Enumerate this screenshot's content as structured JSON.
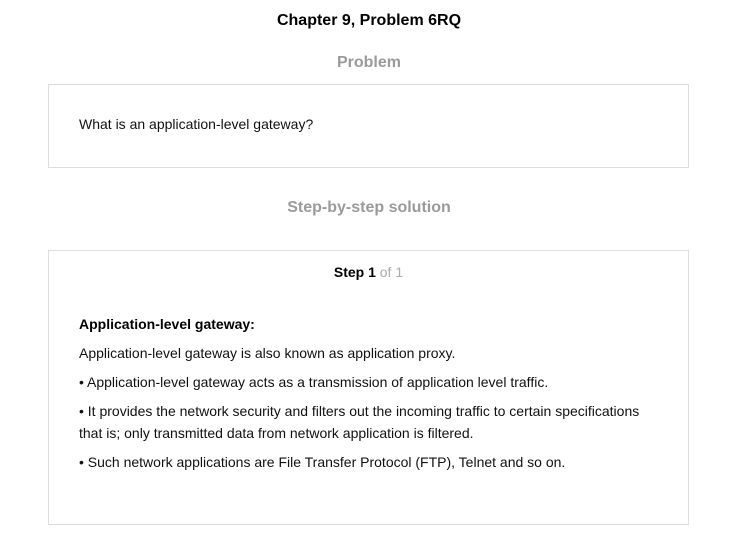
{
  "chapter": {
    "title": "Chapter 9, Problem 6RQ"
  },
  "problem": {
    "heading": "Problem",
    "text": "What is an application-level gateway?"
  },
  "solution": {
    "heading": "Step-by-step solution",
    "step": {
      "label": "Step 1",
      "of": "of 1",
      "title": "Application-level gateway:",
      "paragraphs": [
        "Application-level gateway is also known as application proxy.",
        "• Application-level gateway acts as a transmission of application level traffic.",
        "• It provides the network security and filters out the incoming traffic to certain specifications that is; only transmitted data from network application is filtered.",
        "• Such network applications are File Transfer Protocol (FTP), Telnet and so on."
      ]
    }
  }
}
